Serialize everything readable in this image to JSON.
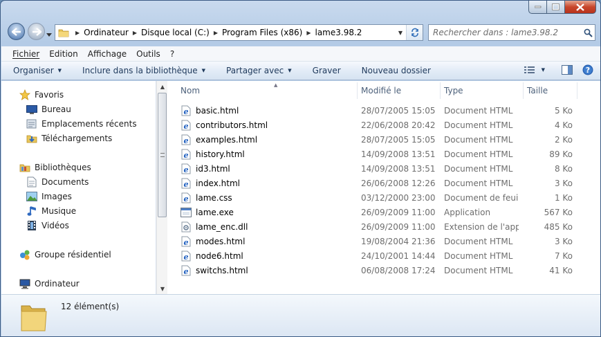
{
  "window": {
    "caption_buttons": [
      "minimize-icon",
      "maximize-icon",
      "close-icon"
    ]
  },
  "address_bar": {
    "breadcrumbs": [
      "Ordinateur",
      "Disque local (C:)",
      "Program Files (x86)",
      "lame3.98.2"
    ]
  },
  "search": {
    "placeholder": "Rechercher dans : lame3.98.2"
  },
  "menu": [
    {
      "label": "Fichier"
    },
    {
      "label": "Edition"
    },
    {
      "label": "Affichage"
    },
    {
      "label": "Outils"
    },
    {
      "label": "?"
    }
  ],
  "commands": [
    {
      "label": "Organiser",
      "dropdown": true
    },
    {
      "label": "Inclure dans la bibliothèque",
      "dropdown": true
    },
    {
      "label": "Partager avec",
      "dropdown": true
    },
    {
      "label": "Graver",
      "dropdown": false
    },
    {
      "label": "Nouveau dossier",
      "dropdown": false
    }
  ],
  "nav_pane": {
    "items": [
      {
        "label": "Favoris",
        "icon": "star-icon",
        "level": 0
      },
      {
        "label": "Bureau",
        "icon": "desktop-icon",
        "level": 1
      },
      {
        "label": "Emplacements récents",
        "icon": "recent-places-icon",
        "level": 1
      },
      {
        "label": "Téléchargements",
        "icon": "downloads-icon",
        "level": 1
      },
      {
        "label": "Bibliothèques",
        "icon": "libraries-icon",
        "level": 0
      },
      {
        "label": "Documents",
        "icon": "documents-icon",
        "level": 1
      },
      {
        "label": "Images",
        "icon": "pictures-icon",
        "level": 1
      },
      {
        "label": "Musique",
        "icon": "music-icon",
        "level": 1
      },
      {
        "label": "Vidéos",
        "icon": "videos-icon",
        "level": 1
      },
      {
        "label": "Groupe résidentiel",
        "icon": "homegroup-icon",
        "level": 0
      },
      {
        "label": "Ordinateur",
        "icon": "computer-icon",
        "level": 0
      }
    ]
  },
  "columns": {
    "name": "Nom",
    "modified": "Modifié le",
    "type": "Type",
    "size": "Taille"
  },
  "files": [
    {
      "name": "basic.html",
      "modified": "28/07/2005 15:05",
      "type": "Document HTML",
      "size": "5 Ko",
      "icon": "html-file-icon"
    },
    {
      "name": "contributors.html",
      "modified": "22/06/2008 20:42",
      "type": "Document HTML",
      "size": "4 Ko",
      "icon": "html-file-icon"
    },
    {
      "name": "examples.html",
      "modified": "28/07/2005 15:05",
      "type": "Document HTML",
      "size": "2 Ko",
      "icon": "html-file-icon"
    },
    {
      "name": "history.html",
      "modified": "14/09/2008 13:51",
      "type": "Document HTML",
      "size": "89 Ko",
      "icon": "html-file-icon"
    },
    {
      "name": "id3.html",
      "modified": "14/09/2008 13:51",
      "type": "Document HTML",
      "size": "8 Ko",
      "icon": "html-file-icon"
    },
    {
      "name": "index.html",
      "modified": "26/06/2008 12:26",
      "type": "Document HTML",
      "size": "3 Ko",
      "icon": "html-file-icon"
    },
    {
      "name": "lame.css",
      "modified": "03/12/2000 23:00",
      "type": "Document de feui...",
      "size": "1 Ko",
      "icon": "css-file-icon"
    },
    {
      "name": "lame.exe",
      "modified": "26/09/2009 11:00",
      "type": "Application",
      "size": "567 Ko",
      "icon": "exe-file-icon"
    },
    {
      "name": "lame_enc.dll",
      "modified": "26/09/2009 11:00",
      "type": "Extension de l'app...",
      "size": "485 Ko",
      "icon": "dll-file-icon"
    },
    {
      "name": "modes.html",
      "modified": "19/08/2004 21:36",
      "type": "Document HTML",
      "size": "3 Ko",
      "icon": "html-file-icon"
    },
    {
      "name": "node6.html",
      "modified": "24/10/2001 14:44",
      "type": "Document HTML",
      "size": "7 Ko",
      "icon": "html-file-icon"
    },
    {
      "name": "switchs.html",
      "modified": "06/08/2008 17:24",
      "type": "Document HTML",
      "size": "41 Ko",
      "icon": "html-file-icon"
    }
  ],
  "status": {
    "count_text": "12 élément(s)"
  },
  "colors": {
    "accent": "#1e395b",
    "ie_blue": "#1f5fbf"
  }
}
